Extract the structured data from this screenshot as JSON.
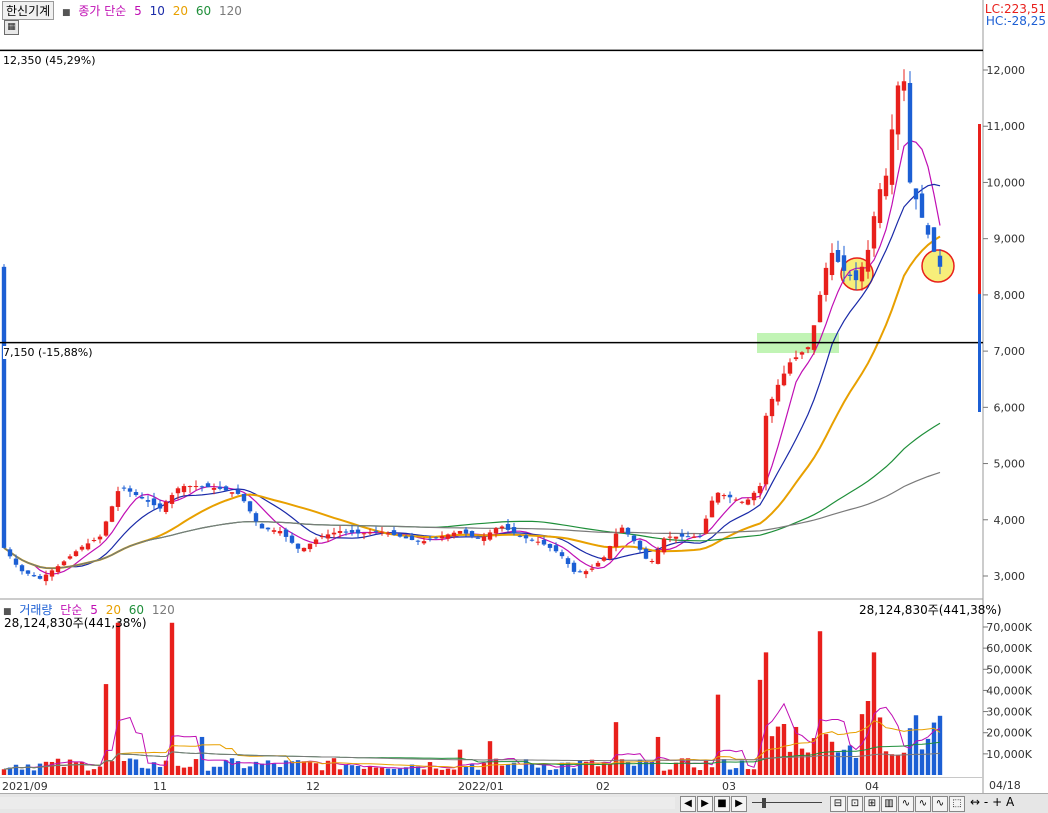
{
  "header": {
    "stock_name": "한신기계",
    "ma_label": "종가 단순",
    "ma_periods": [
      "5",
      "10",
      "20",
      "60",
      "120"
    ],
    "ma_colors": [
      "#c00fb4",
      "#1a2aa8",
      "#e8a000",
      "#1f8f3a",
      "#7a7a7a"
    ]
  },
  "price_panel": {
    "lc": "LC:223,51",
    "hc": "HC:-28,25",
    "upper_line_label": "12,350 (45,29%)",
    "lower_line_label": "7,150 (-15,88%)",
    "y_ticks": [
      "12,000",
      "11,000",
      "10,000",
      "9,000",
      "8,000",
      "7,000",
      "6,000",
      "5,000",
      "4,000",
      "3,000"
    ]
  },
  "volume_panel": {
    "title": "거래량",
    "ma_label": "단순",
    "ma_periods": [
      "5",
      "20",
      "60",
      "120"
    ],
    "ma_colors": [
      "#c00fb4",
      "#e8a000",
      "#1f8f3a",
      "#7a7a7a"
    ],
    "current_left": "28,124,830주(441,38%)",
    "current_right": "28,124,830주(441,38%)",
    "y_ticks": [
      "70,000K",
      "60,000K",
      "50,000K",
      "40,000K",
      "30,000K",
      "20,000K",
      "10,000K"
    ]
  },
  "time_axis": {
    "labels": [
      "2021/09",
      "11",
      "12",
      "2022/01",
      "02",
      "03",
      "04"
    ],
    "right_label": "04/18"
  },
  "colors": {
    "up": "#e8201c",
    "down": "#1c5fd4",
    "highlight_green": "#b6f2a8",
    "highlight_yellow": "#f7ee7a"
  },
  "toolbar": {
    "buttons": [
      "◀",
      "▶",
      "■",
      "▶",
      "-",
      "+",
      "A"
    ]
  }
}
